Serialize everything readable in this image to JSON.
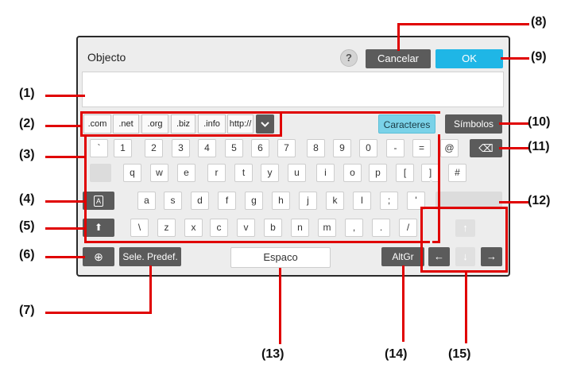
{
  "dialog": {
    "title": "Objecto",
    "help_glyph": "?",
    "cancel_label": "Cancelar",
    "ok_label": "OK",
    "input_value": ""
  },
  "domain_keys": [
    ".com",
    ".net",
    ".org",
    ".biz",
    ".info",
    "http://"
  ],
  "domain_dropdown_icon": "chevron-down-icon",
  "tabs": {
    "characters_label": "Caracteres",
    "symbols_label": "Símbolos"
  },
  "keyboard": {
    "row1": [
      "`",
      "1",
      "2",
      "3",
      "4",
      "5",
      "6",
      "7",
      "8",
      "9",
      "0",
      "-",
      "=",
      "@"
    ],
    "row2": [
      "q",
      "w",
      "e",
      "r",
      "t",
      "y",
      "u",
      "i",
      "o",
      "p",
      "[",
      "]",
      "#"
    ],
    "row3": [
      "a",
      "s",
      "d",
      "f",
      "g",
      "h",
      "j",
      "k",
      "l",
      ";",
      "'"
    ],
    "row4": [
      "\\",
      "z",
      "x",
      "c",
      "v",
      "b",
      "n",
      "m",
      ",",
      ".",
      "/"
    ],
    "caps_glyph": "A",
    "shift_glyph": "⬆",
    "globe_glyph": "⊕",
    "backspace_glyph": "⌫",
    "preset_label": "Sele. Predef.",
    "space_label": "Espaco",
    "altgr_label": "AltGr",
    "arrow_left": "←",
    "arrow_right": "→",
    "arrow_up": "↑",
    "arrow_down": "↓"
  },
  "callouts": [
    "(1)",
    "(2)",
    "(3)",
    "(4)",
    "(5)",
    "(6)",
    "(7)",
    "(8)",
    "(9)",
    "(10)",
    "(11)",
    "(12)",
    "(13)",
    "(14)",
    "(15)"
  ],
  "colors": {
    "ok": "#1fb6e6",
    "dark_button": "#5b5b5b",
    "highlight": "#e00000",
    "active_tab": "#7ad2e8"
  }
}
